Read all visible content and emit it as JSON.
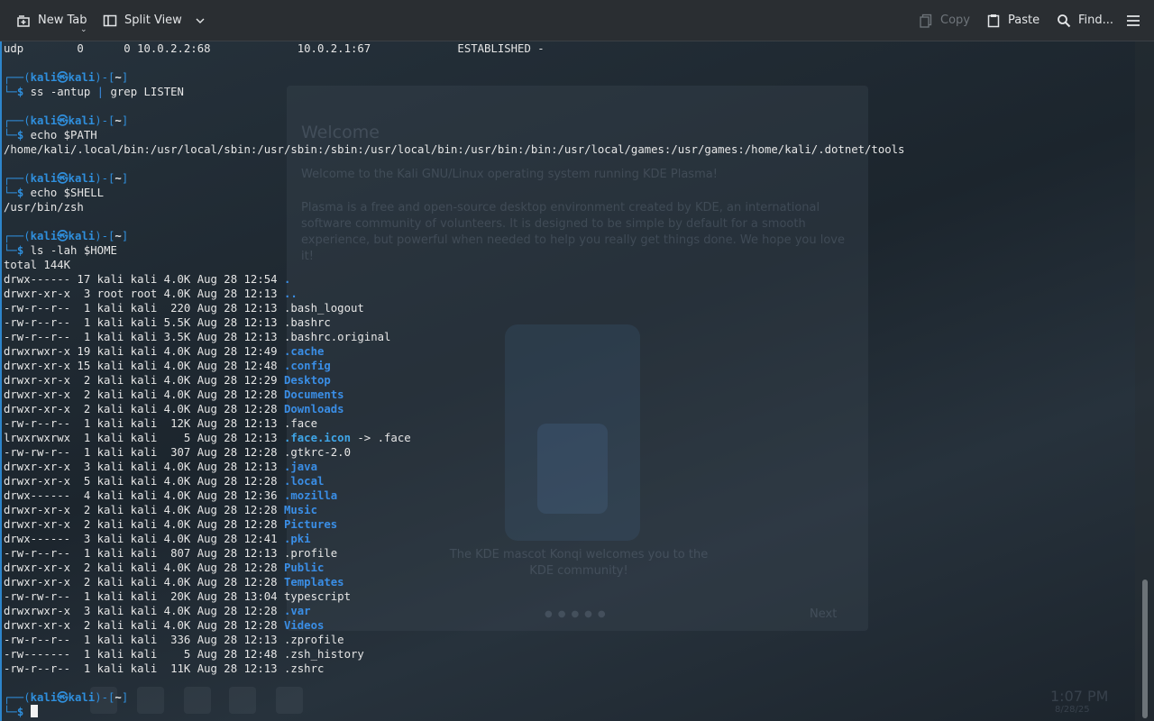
{
  "toolbar": {
    "new_tab": "New Tab",
    "split_view": "Split View",
    "copy": "Copy",
    "paste": "Paste",
    "find": "Find..."
  },
  "terminal": {
    "netstat_line": "udp        0      0 10.0.2.2:68             10.0.2.1:67             ESTABLISHED -",
    "prompt": {
      "user": "kali",
      "host": "kali",
      "dir": "~"
    },
    "commands": {
      "ss": {
        "cmd": "ss",
        "args": " -antup ",
        "pipe": "|",
        "grep": " grep",
        "grep_args": " LISTEN"
      },
      "path": {
        "cmd": "echo",
        "args": " $PATH"
      },
      "shell": {
        "cmd": "echo",
        "args": " $SHELL"
      },
      "ls": {
        "cmd": "ls",
        "args": " -lah $HOME"
      }
    },
    "path_output": "/home/kali/.local/bin:/usr/local/sbin:/usr/sbin:/sbin:/usr/local/bin:/usr/bin:/bin:/usr/local/games:/usr/games:/home/kali/.dotnet/tools",
    "shell_output": "/usr/bin/zsh",
    "ls_total": "total 144K",
    "ls_entries": [
      {
        "meta": "drwx------ 17 kali kali 4.0K Aug 28 12:54 ",
        "name": ".",
        "type": "dir"
      },
      {
        "meta": "drwxr-xr-x  3 root root 4.0K Aug 28 12:13 ",
        "name": "..",
        "type": "dir"
      },
      {
        "meta": "-rw-r--r--  1 kali kali  220 Aug 28 12:13 ",
        "name": ".bash_logout",
        "type": "file"
      },
      {
        "meta": "-rw-r--r--  1 kali kali 5.5K Aug 28 12:13 ",
        "name": ".bashrc",
        "type": "file"
      },
      {
        "meta": "-rw-r--r--  1 kali kali 3.5K Aug 28 12:13 ",
        "name": ".bashrc.original",
        "type": "file"
      },
      {
        "meta": "drwxrwxr-x 19 kali kali 4.0K Aug 28 12:49 ",
        "name": ".cache",
        "type": "dir"
      },
      {
        "meta": "drwxr-xr-x 15 kali kali 4.0K Aug 28 12:48 ",
        "name": ".config",
        "type": "dir"
      },
      {
        "meta": "drwxr-xr-x  2 kali kali 4.0K Aug 28 12:29 ",
        "name": "Desktop",
        "type": "dir"
      },
      {
        "meta": "drwxr-xr-x  2 kali kali 4.0K Aug 28 12:28 ",
        "name": "Documents",
        "type": "dir"
      },
      {
        "meta": "drwxr-xr-x  2 kali kali 4.0K Aug 28 12:28 ",
        "name": "Downloads",
        "type": "dir"
      },
      {
        "meta": "-rw-r--r--  1 kali kali  12K Aug 28 12:13 ",
        "name": ".face",
        "type": "file"
      },
      {
        "meta": "lrwxrwxrwx  1 kali kali    5 Aug 28 12:13 ",
        "name": ".face.icon",
        "type": "link",
        "target": " -> .face"
      },
      {
        "meta": "-rw-rw-r--  1 kali kali  307 Aug 28 12:28 ",
        "name": ".gtkrc-2.0",
        "type": "file"
      },
      {
        "meta": "drwxr-xr-x  3 kali kali 4.0K Aug 28 12:13 ",
        "name": ".java",
        "type": "dir"
      },
      {
        "meta": "drwxr-xr-x  5 kali kali 4.0K Aug 28 12:28 ",
        "name": ".local",
        "type": "dir"
      },
      {
        "meta": "drwx------  4 kali kali 4.0K Aug 28 12:36 ",
        "name": ".mozilla",
        "type": "dir"
      },
      {
        "meta": "drwxr-xr-x  2 kali kali 4.0K Aug 28 12:28 ",
        "name": "Music",
        "type": "dir"
      },
      {
        "meta": "drwxr-xr-x  2 kali kali 4.0K Aug 28 12:28 ",
        "name": "Pictures",
        "type": "dir"
      },
      {
        "meta": "drwx------  3 kali kali 4.0K Aug 28 12:41 ",
        "name": ".pki",
        "type": "dir"
      },
      {
        "meta": "-rw-r--r--  1 kali kali  807 Aug 28 12:13 ",
        "name": ".profile",
        "type": "file"
      },
      {
        "meta": "drwxr-xr-x  2 kali kali 4.0K Aug 28 12:28 ",
        "name": "Public",
        "type": "dir"
      },
      {
        "meta": "drwxr-xr-x  2 kali kali 4.0K Aug 28 12:28 ",
        "name": "Templates",
        "type": "dir"
      },
      {
        "meta": "-rw-rw-r--  1 kali kali  20K Aug 28 13:04 ",
        "name": "typescript",
        "type": "file"
      },
      {
        "meta": "drwxrwxr-x  3 kali kali 4.0K Aug 28 12:28 ",
        "name": ".var",
        "type": "dir"
      },
      {
        "meta": "drwxr-xr-x  2 kali kali 4.0K Aug 28 12:28 ",
        "name": "Videos",
        "type": "dir"
      },
      {
        "meta": "-rw-r--r--  1 kali kali  336 Aug 28 12:13 ",
        "name": ".zprofile",
        "type": "file"
      },
      {
        "meta": "-rw-------  1 kali kali    5 Aug 28 12:48 ",
        "name": ".zsh_history",
        "type": "file"
      },
      {
        "meta": "-rw-r--r--  1 kali kali  11K Aug 28 12:13 ",
        "name": ".zshrc",
        "type": "file"
      }
    ]
  },
  "background": {
    "welcome_title": "Welcome",
    "welcome_p1": "Welcome to the Kali GNU/Linux operating system running KDE Plasma!",
    "welcome_p2": "Plasma is a free and open-source desktop environment created by KDE, an international software community of volunteers. It is designed to be simple by default for a smooth experience, but powerful when needed to help you really get things done. We hope you love it!",
    "welcome_caption": "The KDE mascot Konqi welcomes you to the KDE community!",
    "next_label": "Next",
    "clock_time": "1:07 PM",
    "clock_date": "8/28/25"
  },
  "colors": {
    "prompt_blue": "#2f8fdd",
    "dir_blue": "#3a8ee6",
    "toolbar_bg": "#2a2e32",
    "terminal_text": "#e6e6e6"
  },
  "icons": {
    "new_tab": "new-tab-icon",
    "split_view": "split-view-icon",
    "copy": "copy-icon",
    "paste": "paste-icon",
    "find": "search-icon",
    "menu": "hamburger-menu-icon"
  }
}
